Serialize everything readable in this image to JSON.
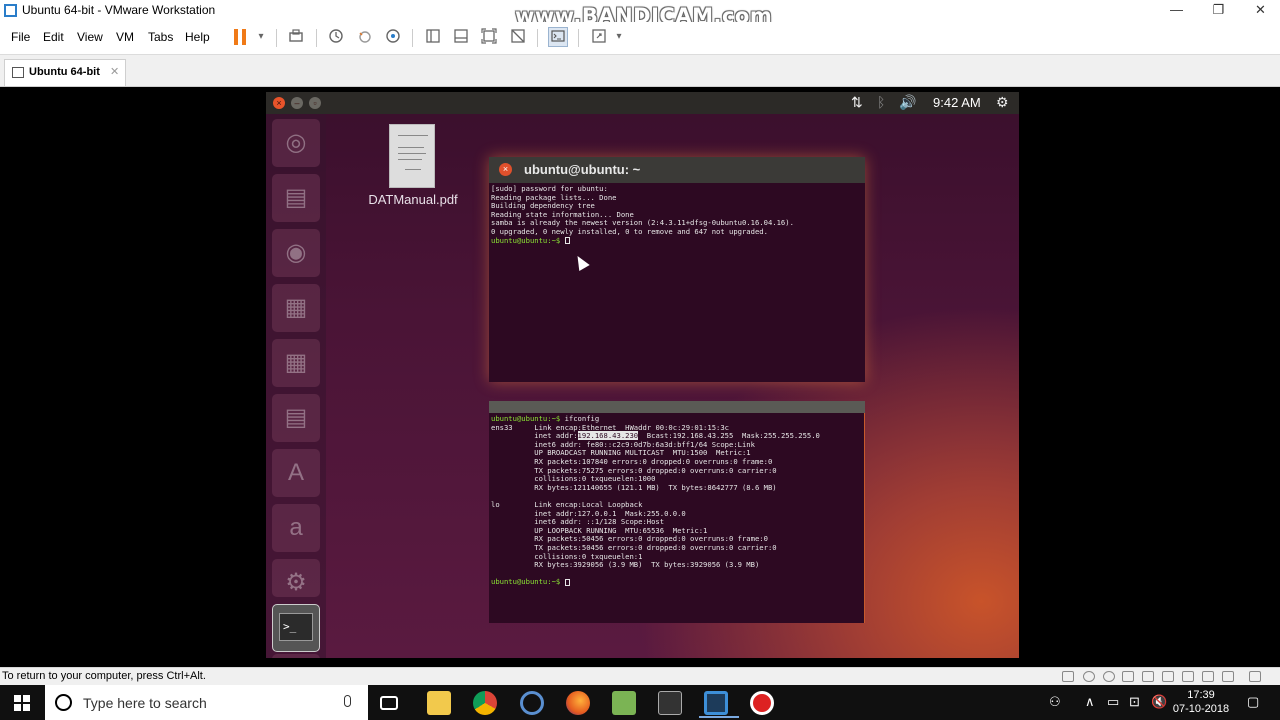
{
  "window": {
    "title": "Ubuntu 64-bit - VMware Workstation",
    "watermark": "www.BANDICAM.com",
    "controls": {
      "minimize": "—",
      "maximize": "❐",
      "close": "✕"
    }
  },
  "menubar": {
    "items": [
      "File",
      "Edit",
      "View",
      "VM",
      "Tabs",
      "Help"
    ],
    "toolbar_icons": [
      "pause-icon",
      "dropdown-arrow-icon",
      "send-keys-icon",
      "snapshot-icon",
      "revert-snapshot-icon",
      "snapshot-manager-icon",
      "library-icon",
      "thumbnail-icon",
      "fullscreen-icon",
      "unity-icon",
      "console-icon",
      "stretch-icon"
    ],
    "dropdown_glyph": "▾"
  },
  "tabs": [
    {
      "label": "Ubuntu 64-bit",
      "close": "✕"
    }
  ],
  "guest": {
    "clock": "9:42 AM",
    "tray_glyphs": {
      "network": "⇅",
      "bluetooth": "ᛒ",
      "volume": "🔊",
      "settings": "⚙"
    },
    "window_buttons": {
      "close": "×",
      "minimize": "–",
      "maximize": "▫"
    },
    "launcher_glyphs": [
      "◎",
      "▤",
      "◉",
      "▦",
      "▦",
      "▤",
      "A",
      "a",
      "⚙",
      "▬"
    ],
    "terminal_glyph": ">_",
    "desktop_file": {
      "name": "DATManual.pdf"
    },
    "terminal1": {
      "title": "ubuntu@ubuntu: ~",
      "close": "×",
      "lines": [
        "[sudo] password for ubuntu:",
        "Reading package lists... Done",
        "Building dependency tree",
        "Reading state information... Done",
        "samba is already the newest version (2:4.3.11+dfsg-0ubuntu0.16.04.16).",
        "0 upgraded, 0 newly installed, 0 to remove and 647 not upgraded."
      ],
      "prompt": "ubuntu@ubuntu:~$ "
    },
    "terminal2": {
      "prompt": "ubuntu@ubuntu:~$ ",
      "command": "ifconfig",
      "ens33_label": "ens33     ",
      "ens33_line1": "Link encap:Ethernet  HWaddr 00:0c:29:01:15:3c",
      "inet_prefix": "          inet addr:",
      "inet_ip": "192.168.43.230",
      "inet_suffix": "  Bcast:192.168.43.255  Mask:255.255.255.0",
      "ens33_rest": [
        "          inet6 addr: fe80::c2c9:0d7b:6a3d:bff1/64 Scope:Link",
        "          UP BROADCAST RUNNING MULTICAST  MTU:1500  Metric:1",
        "          RX packets:107840 errors:0 dropped:0 overruns:0 frame:0",
        "          TX packets:75275 errors:0 dropped:0 overruns:0 carrier:0",
        "          collisions:0 txqueuelen:1000",
        "          RX bytes:121140655 (121.1 MB)  TX bytes:8642777 (8.6 MB)"
      ],
      "lo_lines": [
        "lo        Link encap:Local Loopback",
        "          inet addr:127.0.0.1  Mask:255.0.0.0",
        "          inet6 addr: ::1/128 Scope:Host",
        "          UP LOOPBACK RUNNING  MTU:65536  Metric:1",
        "          RX packets:50456 errors:0 dropped:0 overruns:0 frame:0",
        "          TX packets:50456 errors:0 dropped:0 overruns:0 carrier:0",
        "          collisions:0 txqueuelen:1",
        "          RX bytes:3929056 (3.9 MB)  TX bytes:3929056 (3.9 MB)"
      ]
    }
  },
  "statusbar": {
    "message": "To return to your computer, press Ctrl+Alt."
  },
  "taskbar": {
    "search_placeholder": "Type here to search",
    "apps": [
      "task-view",
      "file-explorer",
      "chrome",
      "app-search",
      "firefox",
      "notepad-plus",
      "terminal-window",
      "vmware",
      "bandicam"
    ],
    "tray_glyphs": {
      "people": "⚇",
      "chevron": "∧",
      "battery": "▭",
      "network": "⊡",
      "volume": "🔇",
      "notifications": "▢"
    },
    "time": "17:39",
    "date": "07-10-2018"
  }
}
